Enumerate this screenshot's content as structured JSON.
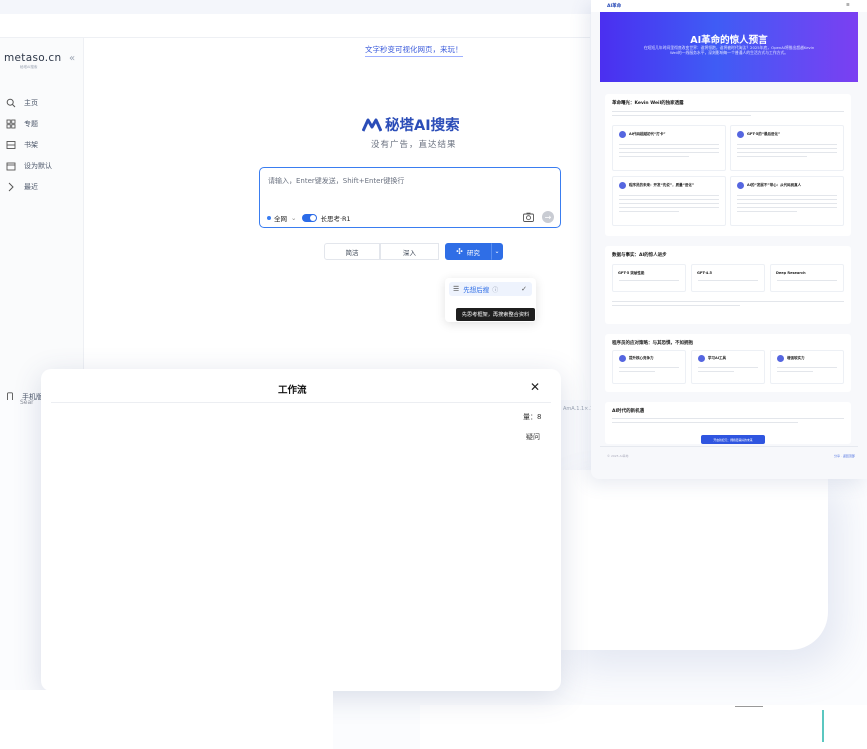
{
  "sidebar": {
    "logo": "metaso.cn",
    "logo_sub": "秘塔AI搜索",
    "collapse_icon": "«",
    "items": [
      {
        "label": "主页",
        "icon": "search-icon"
      },
      {
        "label": "专题",
        "icon": "grid-icon"
      },
      {
        "label": "书架",
        "icon": "bookshelf-icon"
      },
      {
        "label": "设为默认",
        "icon": "calendar-icon"
      },
      {
        "label": "最近",
        "icon": "chevron-right-icon"
      }
    ],
    "phone_label": "手机版"
  },
  "main": {
    "notice": "文字秒变可视化网页，来玩！",
    "brand": "秘塔AI搜索",
    "slogan": "没有广告，直达结果",
    "search": {
      "placeholder": "请输入，Enter键发送，Shift+Enter键换行",
      "scope": "全网",
      "scope_chevron": "⌄",
      "long_think_label": "长思考·R1",
      "send_icon": "→"
    },
    "modes": {
      "brief": "简洁",
      "deep": "深入",
      "research": "研究",
      "spark": "✣",
      "caret": "⌄"
    },
    "dropdown": {
      "item_label": "先想后搜",
      "item_icon": "☰",
      "info": "ⓘ",
      "check": "✓",
      "tooltip": "先思考框架，再搜索整合资料"
    }
  },
  "modal": {
    "title": "工作流",
    "close": "✕",
    "count_text": "量：8",
    "side_text": "疑问"
  },
  "behind": {
    "left_text": "Sear",
    "right_text": "AmA.1.1×.10"
  },
  "report": {
    "logo": "AI革命",
    "menu": "≡",
    "hero_title": "AI革命的惊人预言",
    "hero_sub": "在短短几年时间里彻底改变世界：谁将领跑，谁将被时代淘汰？2025年底，OpenAI将推出超越Kevin Weil的一线服务水平，深刻影响每一个普通人的生活方式与工作方式。",
    "sections": [
      {
        "title": "革命曙光：Kevin Weil的独家透露",
        "cards": [
          "AI代码超越初代“打卡”",
          "GPT-5的“最后进化”",
          "程序员的未来：开发“先说”，质量“进化”",
          "AI的“发展不”带心：从代码到真人"
        ]
      },
      {
        "title": "数据与事实：AI的惊人进步",
        "cards": [
          "GPT-5 突破性能",
          "GPT-4.5",
          "Deep Research"
        ]
      },
      {
        "title": "程序员的应对策略：与其恐惧，不如拥抱",
        "cards": [
          "提升核心竞争力",
          "学习AI工具",
          "增强软实力"
        ]
      },
      {
        "title": "AI时代的新机遇",
        "cards": []
      }
    ],
    "cta": "开启新纪元：拥抱更美好的未来",
    "footer_left": "© 2025 AI革命",
    "footer_right": "分享 · 返回顶部"
  }
}
